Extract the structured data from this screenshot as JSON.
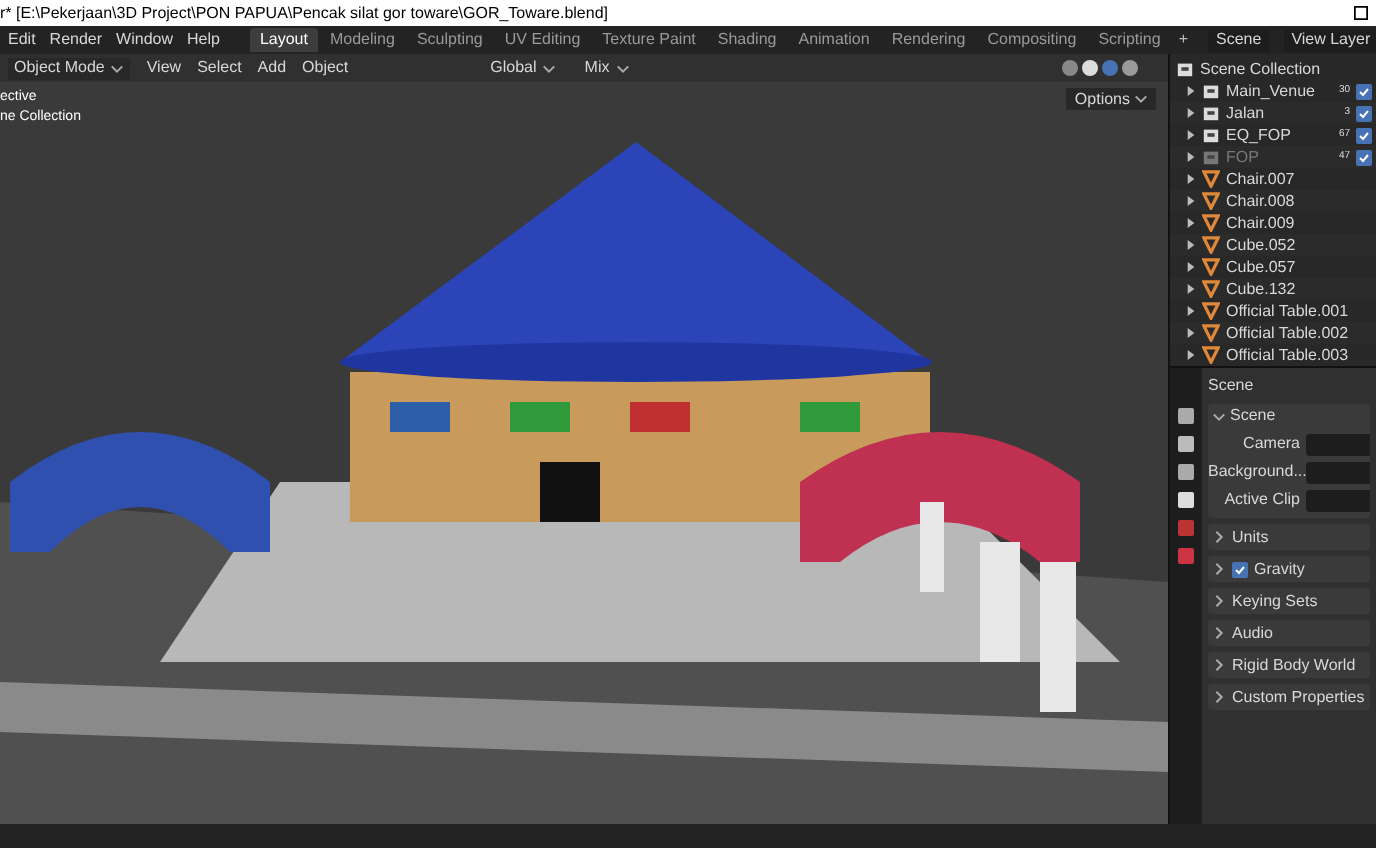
{
  "window": {
    "title": "r* [E:\\Pekerjaan\\3D Project\\PON PAPUA\\Pencak silat gor toware\\GOR_Toware.blend]"
  },
  "menus": [
    "Edit",
    "Render",
    "Window",
    "Help"
  ],
  "workspaces": [
    {
      "label": "Layout",
      "selected": true
    },
    {
      "label": "Modeling",
      "selected": false
    },
    {
      "label": "Sculpting",
      "selected": false
    },
    {
      "label": "UV Editing",
      "selected": false
    },
    {
      "label": "Texture Paint",
      "selected": false
    },
    {
      "label": "Shading",
      "selected": false
    },
    {
      "label": "Animation",
      "selected": false
    },
    {
      "label": "Rendering",
      "selected": false
    },
    {
      "label": "Compositing",
      "selected": false
    },
    {
      "label": "Scripting",
      "selected": false
    }
  ],
  "add_workspace": "+",
  "scene_field": "Scene",
  "view_layer_field": "View Layer",
  "viewport": {
    "mode": "Object Mode",
    "menus": [
      "View",
      "Select",
      "Add",
      "Object"
    ],
    "orientation": "Global",
    "proportional": "Mix",
    "options": "Options",
    "overlay_lines": [
      "ective",
      "ne Collection"
    ]
  },
  "outliner": {
    "root": "Scene Collection",
    "items": [
      {
        "kind": "collection",
        "name": "Main_Venue",
        "count": "30",
        "checked": true,
        "disabled": false
      },
      {
        "kind": "collection",
        "name": "Jalan",
        "count": "3",
        "checked": true,
        "disabled": false
      },
      {
        "kind": "collection",
        "name": "EQ_FOP",
        "count": "67",
        "checked": true,
        "disabled": false
      },
      {
        "kind": "collection",
        "name": "FOP",
        "count": "47",
        "checked": true,
        "disabled": true
      },
      {
        "kind": "mesh",
        "name": "Chair.007",
        "disabled": false
      },
      {
        "kind": "mesh",
        "name": "Chair.008",
        "disabled": false
      },
      {
        "kind": "mesh",
        "name": "Chair.009",
        "disabled": false
      },
      {
        "kind": "mesh",
        "name": "Cube.052",
        "disabled": false
      },
      {
        "kind": "mesh",
        "name": "Cube.057",
        "disabled": false
      },
      {
        "kind": "mesh",
        "name": "Cube.132",
        "disabled": false
      },
      {
        "kind": "mesh",
        "name": "Official Table.001",
        "disabled": false
      },
      {
        "kind": "mesh",
        "name": "Official Table.002",
        "disabled": false
      },
      {
        "kind": "mesh",
        "name": "Official Table.003",
        "disabled": false
      }
    ]
  },
  "properties": {
    "header": "Scene",
    "panel": {
      "title": "Scene",
      "expanded": true,
      "fields": [
        {
          "label": "Camera"
        },
        {
          "label": "Background..."
        },
        {
          "label": "Active Clip"
        }
      ]
    },
    "sections": [
      {
        "label": "Units",
        "expanded": false
      },
      {
        "label": "Gravity",
        "expanded": false,
        "checked": true
      },
      {
        "label": "Keying Sets",
        "expanded": false
      },
      {
        "label": "Audio",
        "expanded": false
      },
      {
        "label": "Rigid Body World",
        "expanded": false
      },
      {
        "label": "Custom Properties",
        "expanded": false
      }
    ]
  }
}
